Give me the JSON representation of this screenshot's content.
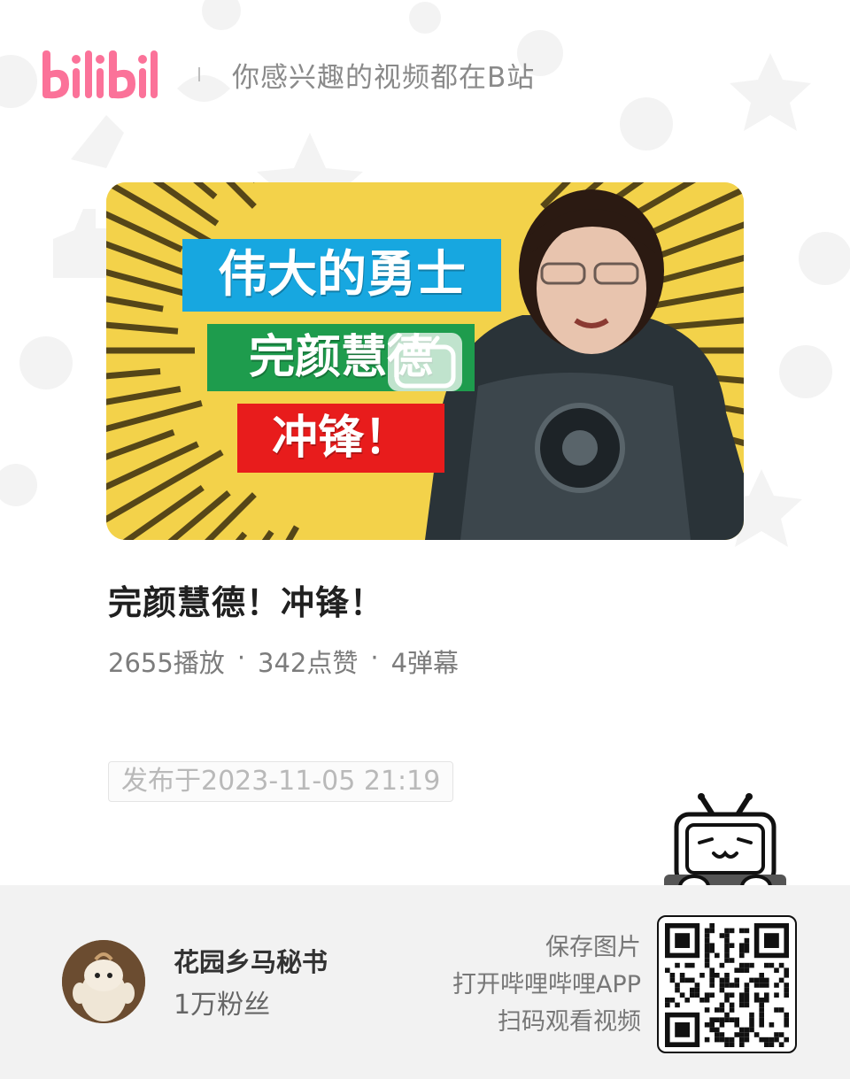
{
  "header": {
    "logo_text": "bilibili",
    "tagline": "你感兴趣的视频都在B站"
  },
  "cover": {
    "labels": [
      "伟大的勇士",
      "完颜慧德",
      "冲锋！"
    ]
  },
  "video": {
    "title": "完颜慧德！冲锋！",
    "stats": [
      "2655播放",
      "·",
      "342点赞",
      "·",
      "4弹幕"
    ],
    "publish_time": "发布于2023-11-05 21:19"
  },
  "author": {
    "name": "花园乡马秘书",
    "fans": "1万粉丝"
  },
  "cta": {
    "line1": "保存图片",
    "line2": "打开哔哩哔哩APP",
    "line3": "扫码观看视频"
  },
  "colors": {
    "brand_pink": "#fb7299",
    "cover_yellow": "#f3d24a",
    "label_blue": "#17a7e0",
    "label_green": "#1e9c4d",
    "label_red": "#e81c1c"
  },
  "icons": [
    "bilibili-logo",
    "tv-mascot-icon",
    "qr-code",
    "tv-badge-icon"
  ]
}
